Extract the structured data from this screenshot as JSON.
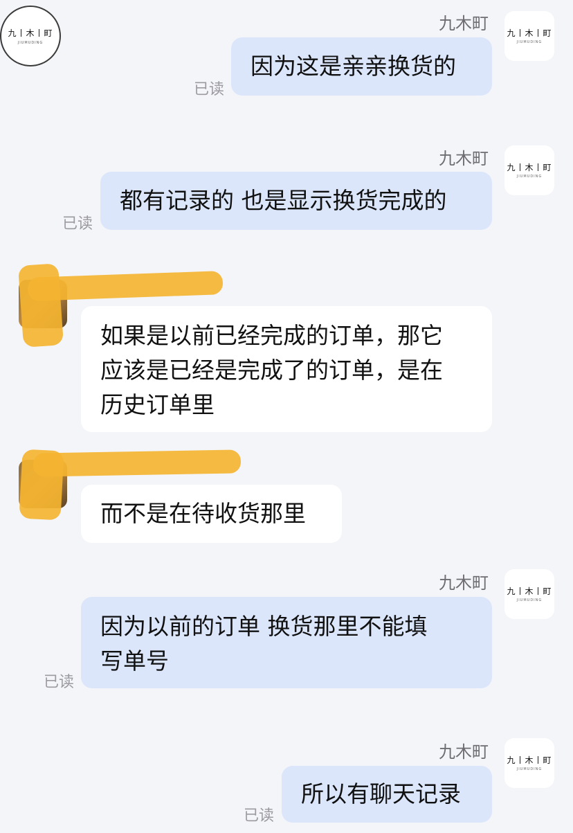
{
  "shop": {
    "name": "九木町",
    "logo_text": "九丨木丨町",
    "logo_sub": "JIUMUDING"
  },
  "read_label": "已读",
  "messages": [
    {
      "side": "me",
      "text": "因为这是亲亲换货的"
    },
    {
      "side": "me",
      "text": "都有记录的 也是显示换货完成的"
    },
    {
      "side": "them",
      "lines": [
        "如果是以前已经完成的订单，那它",
        "应该是已经是完成了的订单，是在",
        "历史订单里"
      ]
    },
    {
      "side": "them",
      "text": "而不是在待收货那里"
    },
    {
      "side": "me",
      "lines": [
        "因为以前的订单 换货那里不能填",
        "写单号"
      ]
    },
    {
      "side": "me",
      "text": "所以有聊天记录"
    }
  ],
  "colors": {
    "background": "#f4f5f9",
    "my_bubble": "#dbe6fb",
    "their_bubble": "#ffffff",
    "redaction": "#f4b431"
  }
}
